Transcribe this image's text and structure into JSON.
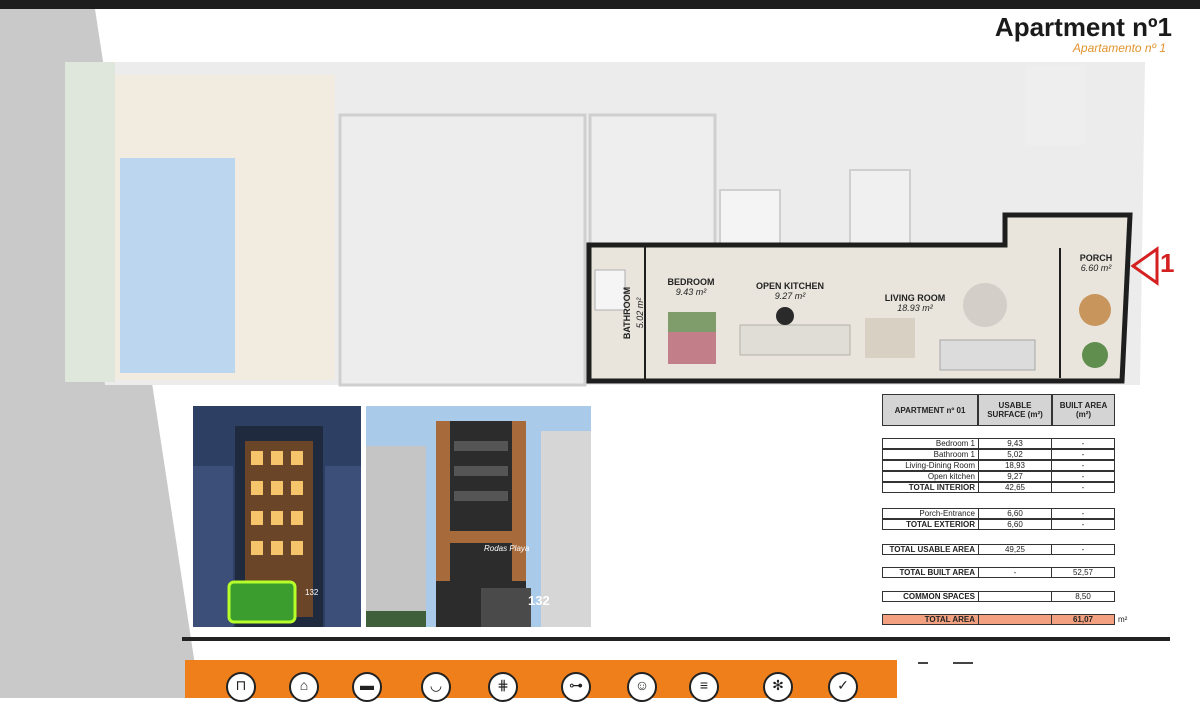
{
  "header": {
    "title": "Apartment nº1",
    "subtitle": "Apartamento nº 1"
  },
  "plan": {
    "apartment_marker": "1",
    "rooms": [
      {
        "id": "porch",
        "label": "PORCH",
        "area": "6.60 m²"
      },
      {
        "id": "bedroom",
        "label": "BEDROOM",
        "area": "9.43 m²"
      },
      {
        "id": "kitchen",
        "label": "OPEN KITCHEN",
        "area": "9.27 m²"
      },
      {
        "id": "living",
        "label": "LIVING ROOM",
        "area": "18.93 m²"
      },
      {
        "id": "bathroom",
        "label": "BATHROOM",
        "area": "5.02 m²"
      }
    ]
  },
  "photos": {
    "building_sign": "Rodas Playa",
    "street_number": "132"
  },
  "table": {
    "header": {
      "title": "APARTMENT nº 01",
      "usable": "USABLE SURFACE (m²)",
      "built": "BUILT AREA (m²)"
    },
    "rows": [
      {
        "label": "Bedroom 1",
        "usable": "9,43",
        "built": "-"
      },
      {
        "label": "Bathroom 1",
        "usable": "5,02",
        "built": "-"
      },
      {
        "label": "Living-Dining Room",
        "usable": "18,93",
        "built": "-"
      },
      {
        "label": "Open kitchen",
        "usable": "9,27",
        "built": "-"
      },
      {
        "label": "TOTAL INTERIOR",
        "usable": "42,65",
        "built": "-"
      },
      {
        "label": "Porch-Entrance",
        "usable": "6,60",
        "built": "-"
      },
      {
        "label": "TOTAL EXTERIOR",
        "usable": "6,60",
        "built": "-"
      },
      {
        "label": "TOTAL USABLE AREA",
        "usable": "49,25",
        "built": "-"
      },
      {
        "label": "TOTAL BUILT AREA",
        "usable": "-",
        "built": "52,57"
      },
      {
        "label": "COMMON SPACES",
        "usable": "",
        "built": "8,50"
      },
      {
        "label": "TOTAL AREA",
        "usable": "",
        "built": "61,07"
      }
    ],
    "unit": "m²"
  },
  "amenities": [
    {
      "icon": "bed-size-icon",
      "glyph": "⊓"
    },
    {
      "icon": "house-icon",
      "glyph": "⌂"
    },
    {
      "icon": "bed-icon",
      "glyph": "▬"
    },
    {
      "icon": "bathtub-icon",
      "glyph": "◡"
    },
    {
      "icon": "pool-ladder-icon",
      "glyph": "⋕"
    },
    {
      "icon": "gym-icon",
      "glyph": "⊶"
    },
    {
      "icon": "community-icon",
      "glyph": "☺"
    },
    {
      "icon": "elevator-icon",
      "glyph": "≡"
    },
    {
      "icon": "air-conditioning-icon",
      "glyph": "✻"
    },
    {
      "icon": "quality-badge-icon",
      "glyph": "✓"
    }
  ],
  "colors": {
    "accent_orange": "#ef7f1a",
    "subtitle_orange": "#e0942e",
    "total_row": "#f2a07f",
    "marker_red": "#d42020"
  }
}
